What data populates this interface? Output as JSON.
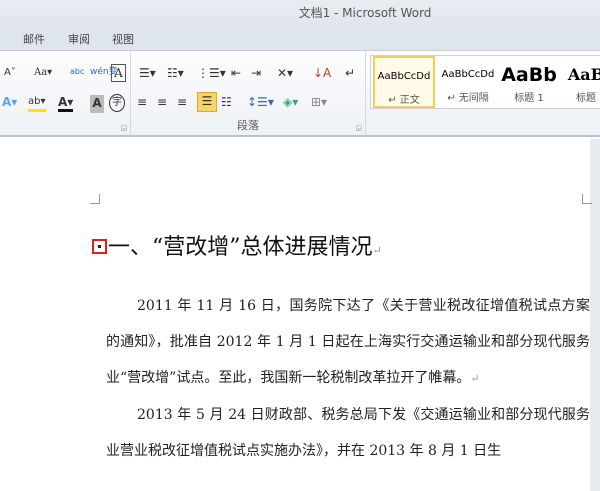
{
  "window": {
    "title": "文档1 - Microsoft Word"
  },
  "tabs": [
    "邮件",
    "审阅",
    "视图"
  ],
  "ribbon": {
    "paragraph_group_label": "段落",
    "styles": [
      {
        "preview": "AaBbCcDd",
        "name": "↵ 正文"
      },
      {
        "preview": "AaBbCcDd",
        "name": "↵ 无间隔"
      },
      {
        "preview": "AaBb",
        "name": "标题 1"
      },
      {
        "preview": "AaB",
        "name": "标题"
      }
    ],
    "font_icons": {
      "shrink": "A˅",
      "case": "Aa▾",
      "phonetic": "abc",
      "wen": "wén变",
      "border_char": "A",
      "text_effect": "A▾",
      "highlight": "ab▾",
      "font_color": "A▾",
      "shading_char": "A",
      "enclose": "字"
    }
  },
  "document": {
    "heading": "一、“营改增”总体进展情况",
    "paragraphs": [
      "2011 年 11 月 16 日，国务院下达了《关于营业税改征增值税试点方案的通知》，批准自 2012 年 1 月 1 日起在上海实行交通运输业和部分现代服务业“营改增”试点。至此，我国新一轮税制改革拉开了帷幕。",
      "2013 年 5 月 24 日财政部、税务总局下发《交通运输业和部分现代服务业营业税改征增值税试点实施办法》，并在 2013 年 8 月 1 日生"
    ],
    "paragraph_mark": "↵"
  }
}
